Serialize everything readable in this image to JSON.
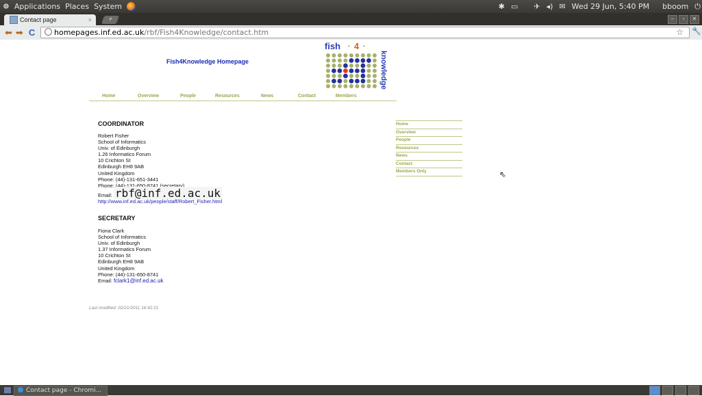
{
  "top_panel": {
    "menus": [
      "Applications",
      "Places",
      "System"
    ],
    "clock": "Wed 29 Jun,  5:40 PM",
    "user": "bboom"
  },
  "browser": {
    "tab_title": "Contact page",
    "tab_close": "×",
    "url_host": "homepages.inf.ed.ac.uk",
    "url_path": "/rbf/Fish4Knowledge/contact.htm"
  },
  "site": {
    "title": "Fish4Knowledge Homepage",
    "logo_text": "fish",
    "logo_num": "4",
    "logo_word": "knowledge",
    "nav": [
      "Home",
      "Overview",
      "People",
      "Resources",
      "News",
      "Contact",
      "Members"
    ],
    "side_nav": [
      "Home",
      "Overview",
      "People",
      "Resources",
      "News",
      "Contact",
      "Members Only"
    ],
    "last_modified": "Last modified: 02/21/2011 16:42:21"
  },
  "coordinator": {
    "heading": "COORDINATOR",
    "lines": [
      "Robert Fisher",
      "School of Informatics",
      "Univ. of Edinburgh",
      "1.26 Informatics Forum",
      "10 Crichton St",
      "Edinburgh EH8 9AB",
      "United Kingdom",
      "Phone: (44)-131-651-3441",
      "Phone: (44)-131-650-8741 (secretary)"
    ],
    "email_label": "Email:",
    "email": "rbf@inf.ed.ac.uk",
    "url": "http://www.inf.ed.ac.uk/people/staff/Robert_Fisher.html"
  },
  "secretary": {
    "heading": "SECRETARY",
    "lines": [
      "Fiona Clark",
      "School of Informatics",
      "Univ. of Edinburgh",
      "1.37 Informatics Forum",
      "10 Crichton St",
      "Edinburgh EH8 9AB",
      "United Kingdom",
      "Phone: (44)-131-650-8741"
    ],
    "email_label": "Email:",
    "email": "fclark1@inf.ed.ac.uk"
  },
  "taskbar": {
    "task_label": "Contact page - Chromi..."
  }
}
